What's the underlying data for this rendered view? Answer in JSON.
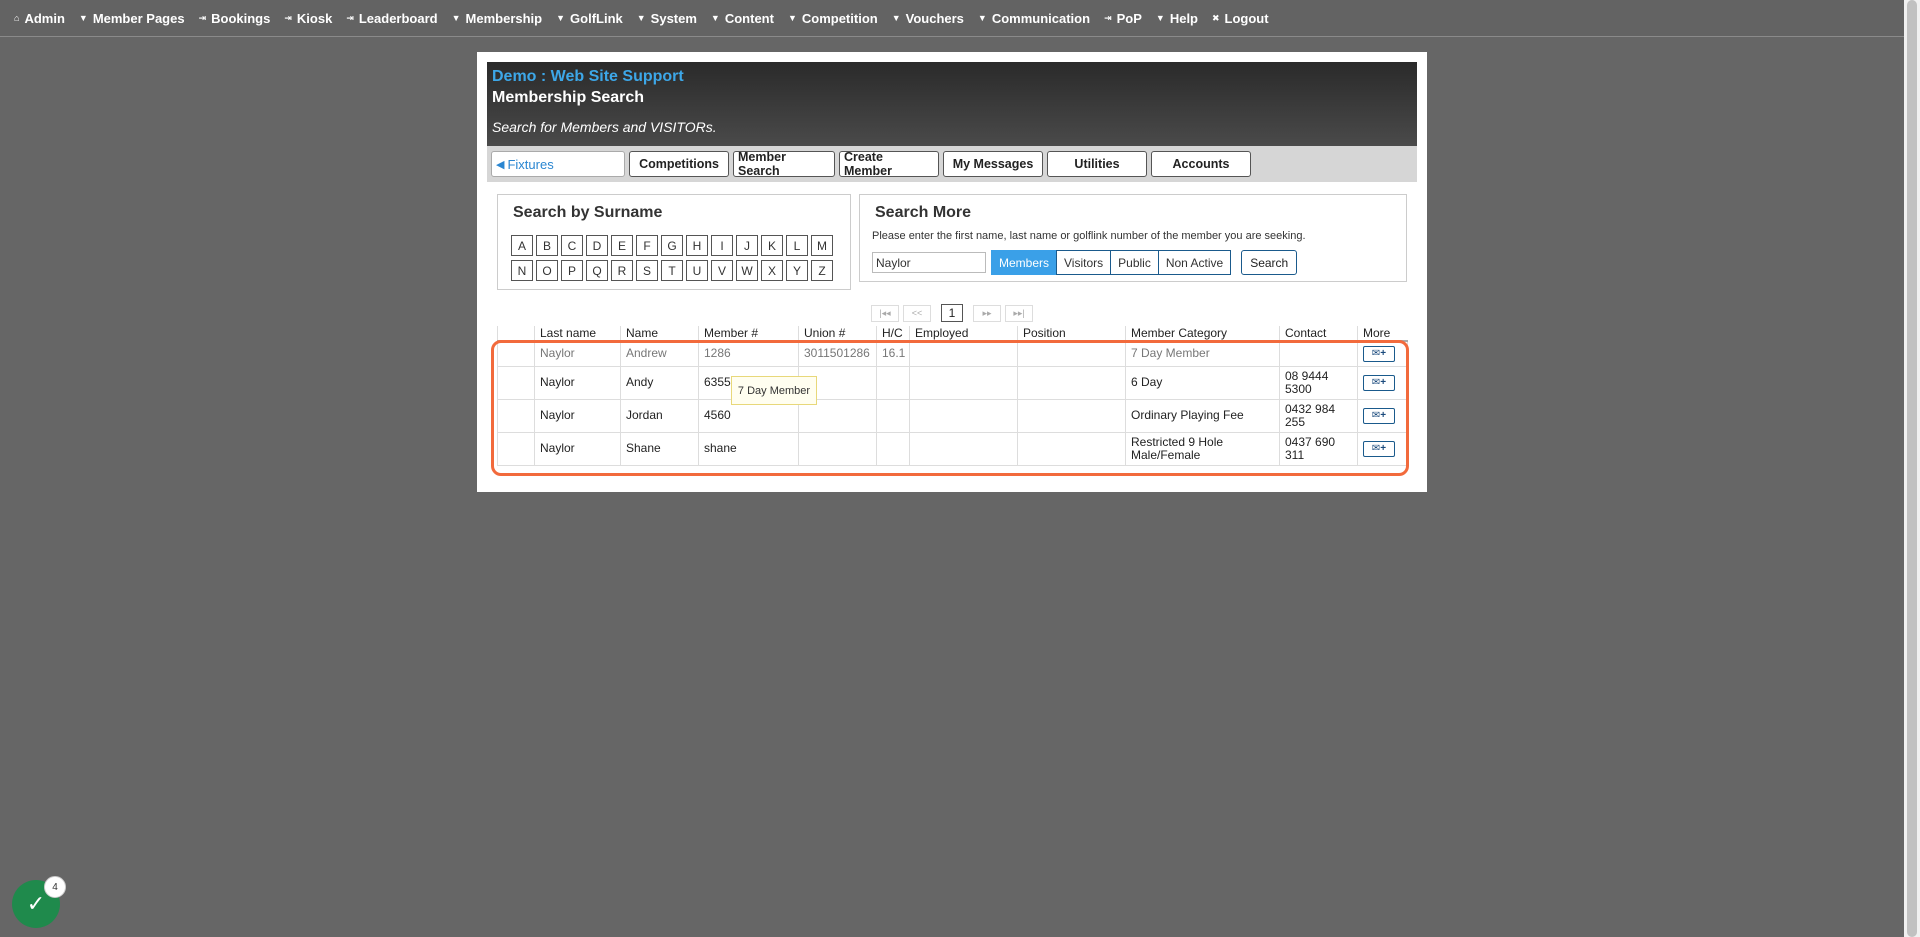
{
  "nav": [
    {
      "glyph": "⌂",
      "label": "Admin",
      "icon": "home-icon"
    },
    {
      "glyph": "▼",
      "label": "Member Pages",
      "icon": "dropdown-icon"
    },
    {
      "glyph": "⇥",
      "label": "Bookings",
      "icon": "link-icon"
    },
    {
      "glyph": "⇥",
      "label": "Kiosk",
      "icon": "link-icon"
    },
    {
      "glyph": "⇥",
      "label": "Leaderboard",
      "icon": "link-icon"
    },
    {
      "glyph": "▼",
      "label": "Membership",
      "icon": "dropdown-icon"
    },
    {
      "glyph": "▼",
      "label": "GolfLink",
      "icon": "dropdown-icon"
    },
    {
      "glyph": "▼",
      "label": "System",
      "icon": "dropdown-icon"
    },
    {
      "glyph": "▼",
      "label": "Content",
      "icon": "dropdown-icon"
    },
    {
      "glyph": "▼",
      "label": "Competition",
      "icon": "dropdown-icon"
    },
    {
      "glyph": "▼",
      "label": "Vouchers",
      "icon": "dropdown-icon"
    },
    {
      "glyph": "▼",
      "label": "Communication",
      "icon": "dropdown-icon"
    },
    {
      "glyph": "⇥",
      "label": "PoP",
      "icon": "link-icon"
    },
    {
      "glyph": "▼",
      "label": "Help",
      "icon": "dropdown-icon"
    },
    {
      "glyph": "✖",
      "label": "Logout",
      "icon": "close-icon"
    }
  ],
  "header": {
    "site_title": "Demo : Web Site Support",
    "page_title": "Membership Search",
    "subtitle": "Search for Members and VISITORs."
  },
  "tabs": {
    "back_label": "Fixtures",
    "items": [
      "Competitions",
      "Member Search",
      "Create Member",
      "My Messages",
      "Utilities",
      "Accounts"
    ]
  },
  "surname_search": {
    "title": "Search by Surname",
    "row1": [
      "A",
      "B",
      "C",
      "D",
      "E",
      "F",
      "G",
      "H",
      "I",
      "J",
      "K",
      "L",
      "M"
    ],
    "row2": [
      "N",
      "O",
      "P",
      "Q",
      "R",
      "S",
      "T",
      "U",
      "V",
      "W",
      "X",
      "Y",
      "Z"
    ]
  },
  "search_more": {
    "title": "Search More",
    "hint": "Please enter the first name, last name or golflink number of the member you are seeking.",
    "input_value": "Naylor",
    "filters": [
      "Members",
      "Visitors",
      "Public",
      "Non Active"
    ],
    "active_filter": "Members",
    "search_label": "Search"
  },
  "pager": {
    "first": "|◂◂",
    "prev": "<<",
    "current": "1",
    "next": "▸▸",
    "last": "▸▸|"
  },
  "table": {
    "columns": [
      "",
      "Last name",
      "Name",
      "Member #",
      "Union #",
      "H/C",
      "Employed",
      "Position",
      "Member Category",
      "Contact",
      "More"
    ],
    "rows": [
      {
        "last": "Naylor",
        "name": "Andrew",
        "member": "1286",
        "union": "3011501286",
        "hc": "16.1",
        "employed": "",
        "position": "",
        "category": "7 Day Member",
        "contact": ""
      },
      {
        "last": "Naylor",
        "name": "Andy",
        "member": "6355",
        "union": "",
        "hc": "",
        "employed": "",
        "position": "",
        "category": "6 Day",
        "contact": "08 9444 5300"
      },
      {
        "last": "Naylor",
        "name": "Jordan",
        "member": "4560",
        "union": "",
        "hc": "",
        "employed": "",
        "position": "",
        "category": "Ordinary Playing Fee",
        "contact": "0432 984 255"
      },
      {
        "last": "Naylor",
        "name": "Shane",
        "member": "shane",
        "union": "",
        "hc": "",
        "employed": "",
        "position": "",
        "category": "Restricted 9 Hole Male/Female",
        "contact": "0437 690 311"
      }
    ],
    "more_glyph": "✉+"
  },
  "tooltip": "7 Day Member",
  "fab": {
    "glyph": "✓",
    "badge": "4"
  },
  "colors": {
    "accent": "#3aa0e8",
    "highlight": "#f26a3c",
    "fab": "#1f8a4c"
  }
}
